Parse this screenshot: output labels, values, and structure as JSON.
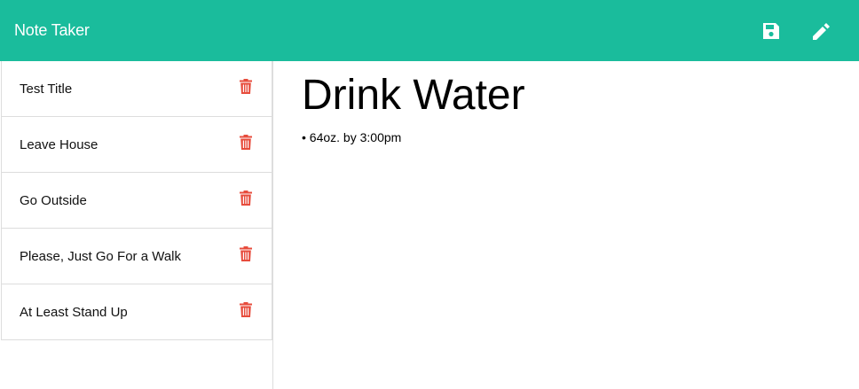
{
  "navbar": {
    "brand": "Note Taker",
    "save_icon": "save-icon",
    "new_note_icon": "pencil-icon"
  },
  "colors": {
    "navbar_bg": "#1abc9c",
    "delete_icon": "#e74c3c",
    "border": "#dddddd"
  },
  "notes": [
    {
      "title": "Test Title",
      "icon": "trash-icon"
    },
    {
      "title": "Leave House",
      "icon": "trash-icon"
    },
    {
      "title": "Go Outside",
      "icon": "trash-icon"
    },
    {
      "title": "Please, Just Go For a Walk",
      "icon": "trash-icon"
    },
    {
      "title": "At Least Stand Up",
      "icon": "trash-icon"
    }
  ],
  "active_note": {
    "title": "Drink Water",
    "text": "• 64oz. by 3:00pm"
  }
}
